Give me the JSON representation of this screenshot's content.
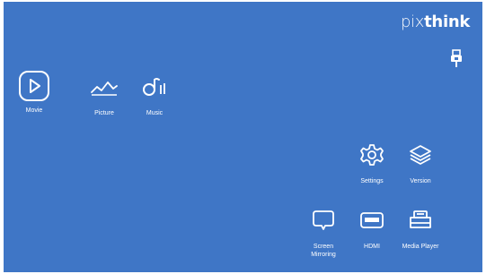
{
  "brand": {
    "part1": "pix",
    "part2": "think"
  },
  "status": {
    "usb_icon": "usb-icon"
  },
  "apps": {
    "movie": {
      "label": "Movie",
      "icon": "play-circle-icon"
    },
    "picture": {
      "label": "Picture",
      "icon": "picture-wave-icon"
    },
    "music": {
      "label": "Music",
      "icon": "music-note-icon"
    },
    "settings": {
      "label": "Settings",
      "icon": "gear-icon"
    },
    "version": {
      "label": "Version",
      "icon": "layers-icon"
    },
    "screen_mirroring": {
      "label": "Screen\nMirroring",
      "icon": "screen-mirroring-icon"
    },
    "hdmi": {
      "label": "HDMI",
      "icon": "hdmi-icon"
    },
    "media_player": {
      "label": "Media Player",
      "icon": "media-player-icon"
    }
  },
  "colors": {
    "background": "#3f76c6",
    "foreground": "#ffffff"
  }
}
